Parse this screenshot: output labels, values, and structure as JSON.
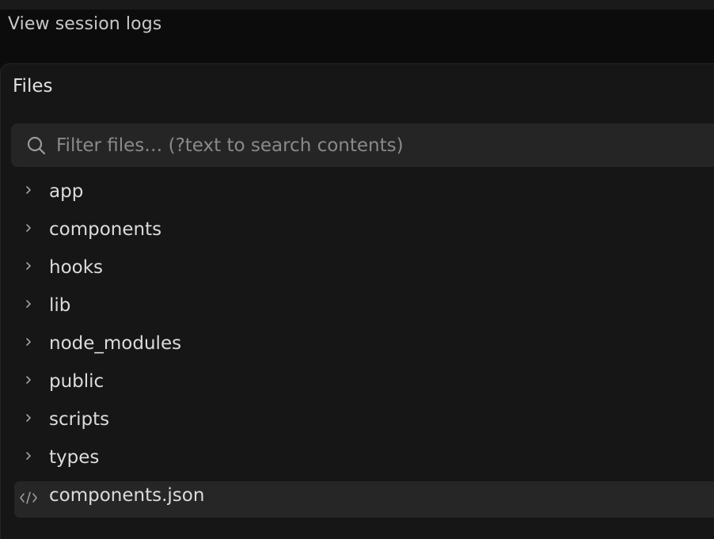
{
  "header": {
    "session_logs_label": "View session logs"
  },
  "files_panel": {
    "title": "Files",
    "search": {
      "placeholder": "Filter files… (?text to search contents)",
      "value": ""
    },
    "items": [
      {
        "label": "app",
        "kind": "folder",
        "icon": "chevron-right-icon"
      },
      {
        "label": "components",
        "kind": "folder",
        "icon": "chevron-right-icon"
      },
      {
        "label": "hooks",
        "kind": "folder",
        "icon": "chevron-right-icon"
      },
      {
        "label": "lib",
        "kind": "folder",
        "icon": "chevron-right-icon"
      },
      {
        "label": "node_modules",
        "kind": "folder",
        "icon": "chevron-right-icon"
      },
      {
        "label": "public",
        "kind": "folder",
        "icon": "chevron-right-icon"
      },
      {
        "label": "scripts",
        "kind": "folder",
        "icon": "chevron-right-icon"
      },
      {
        "label": "types",
        "kind": "folder",
        "icon": "chevron-right-icon"
      },
      {
        "label": "components.json",
        "kind": "file",
        "icon": "code-file-icon",
        "selected": true
      }
    ]
  },
  "colors": {
    "background": "#0c0c0c",
    "panel": "#161616",
    "search_bg": "#252525",
    "selected_row": "#262626",
    "text": "#dcdcdc",
    "muted": "#8a8a8a"
  }
}
